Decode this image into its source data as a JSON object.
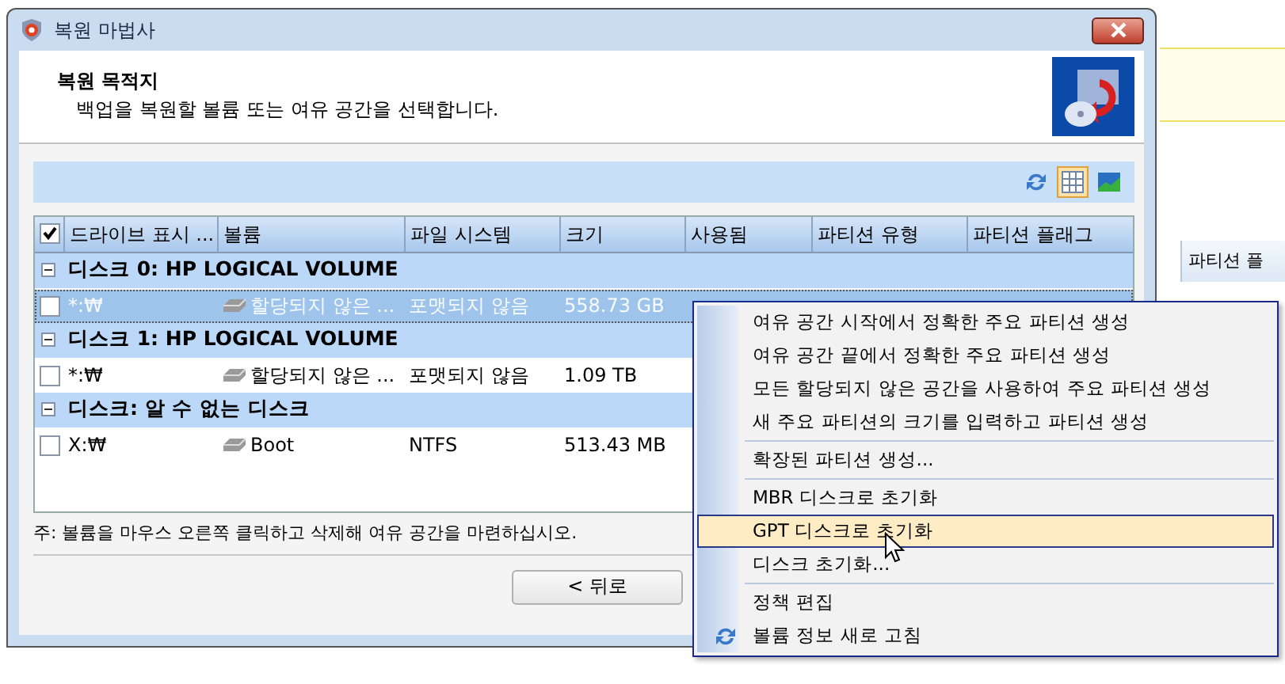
{
  "window": {
    "title": "복원 마법사"
  },
  "header": {
    "title": "복원 목적지",
    "subtitle": "백업을 복원할 볼륨 또는 여유 공간을 선택합니다."
  },
  "toolbar": {
    "buttons": [
      {
        "kind": "refresh",
        "selected": false
      },
      {
        "kind": "grid",
        "selected": true
      },
      {
        "kind": "chart",
        "selected": false
      }
    ]
  },
  "table": {
    "all_checked": true,
    "columns": [
      "드라이브 표시 ...",
      "볼륨",
      "파일 시스템",
      "크기",
      "사용됨",
      "파티션 유형",
      "파티션 플래그"
    ],
    "groups": [
      {
        "title": "디스크 0: HP LOGICAL VOLUME",
        "expanded": true,
        "rows": [
          {
            "checked": false,
            "selected": true,
            "drive": "*:₩",
            "volume": "할당되지 않은 ...",
            "file_system": "포맷되지 않음",
            "size": "558.73 GB"
          }
        ]
      },
      {
        "title": "디스크 1: HP LOGICAL VOLUME",
        "expanded": true,
        "rows": [
          {
            "checked": false,
            "selected": false,
            "drive": "*:₩",
            "volume": "할당되지 않은 ...",
            "file_system": "포맷되지 않음",
            "size": "1.09 TB"
          }
        ]
      },
      {
        "title": "디스크: 알 수 없는 디스크",
        "expanded": true,
        "rows": [
          {
            "checked": false,
            "selected": false,
            "drive": "X:₩",
            "volume": "Boot",
            "file_system": "NTFS",
            "size": "513.43 MB"
          }
        ]
      }
    ]
  },
  "note": "주: 볼륨을 마우스 오른쪽 클릭하고 삭제해 여유 공간을 마련하십시오.",
  "buttons": [
    {
      "label": "< 뒤로"
    }
  ],
  "background": {
    "column_header": "파티션 플"
  },
  "context_menu": {
    "groups": [
      [
        {
          "label": "여유 공간 시작에서 정확한 주요 파티션 생성",
          "kind": "plain",
          "selected": false
        },
        {
          "label": "여유 공간 끝에서 정확한 주요 파티션 생성",
          "kind": "plain",
          "selected": false
        },
        {
          "label": "모든 할당되지 않은 공간을 사용하여 주요 파티션 생성",
          "kind": "plain",
          "selected": false
        },
        {
          "label": "새 주요 파티션의 크기를 입력하고 파티션 생성",
          "kind": "plain",
          "selected": false
        }
      ],
      [
        {
          "label": "확장된 파티션 생성...",
          "kind": "plain",
          "selected": false
        }
      ],
      [
        {
          "label": "MBR 디스크로 초기화",
          "kind": "plain",
          "selected": false
        },
        {
          "label": "GPT 디스크로 초기화",
          "kind": "plain",
          "selected": true
        },
        {
          "label": "디스크 초기화...",
          "kind": "plain",
          "selected": false
        }
      ],
      [
        {
          "label": "정책 편집",
          "kind": "plain",
          "selected": false
        },
        {
          "label": "볼륨 정보 새로 고침",
          "kind": "refresh",
          "selected": false
        }
      ]
    ]
  }
}
